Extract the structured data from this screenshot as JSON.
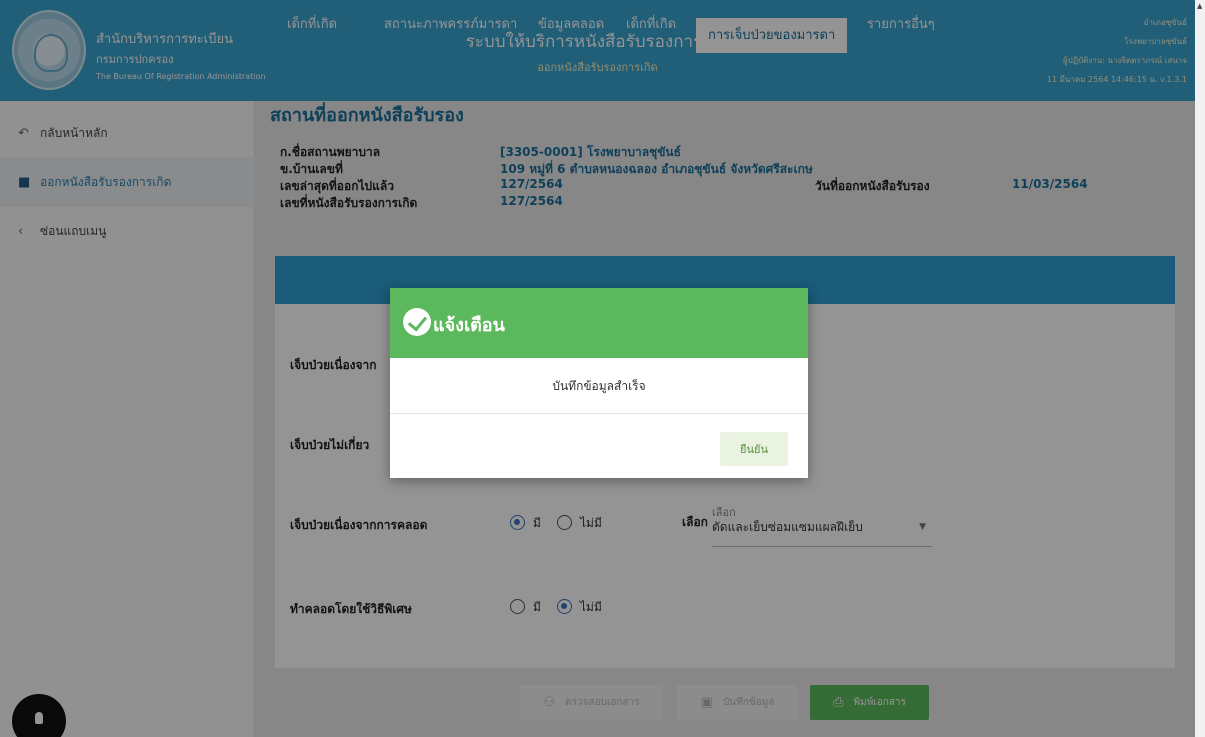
{
  "header": {
    "org_line1": "สำนักบริหารการทะเบียน",
    "org_line2": "กรมการปกครอง",
    "org_line3": "The Bureau Of Registration Administration",
    "system_title": "ระบบให้บริการหนังสือรับรองการเกิด",
    "system_subtitle": "ออกหนังสือรับรองการเกิด",
    "user_district": "อำเภอชุขันธ์",
    "user_hospital": "โรงพยาบาลชุขันธ์",
    "user_name": "ผู้ปฏิบัติงาน: นางจิตตราภรณ์ เสนาจ",
    "datetime_version": "11 มีนาคม 2564 14:46:15 น.  v.1.3.1"
  },
  "sidebar": {
    "items": [
      {
        "label": "กลับหน้าหลัก",
        "icon": "back-icon"
      },
      {
        "label": "ออกหนังสือรับรองการเกิด",
        "icon": "document-icon"
      },
      {
        "label": "ซ่อนแถบเมนู",
        "icon": "chevron-left-icon"
      }
    ]
  },
  "main": {
    "title": "สถานที่ออกหนังสือรับรอง",
    "info": {
      "hospital_label": "ก.ชื่อสถานพยาบาล",
      "hospital_value": "[3305-0001] โรงพยาบาลชุขันธ์",
      "address_label": "ข.บ้านเลขที่",
      "address_value": "109 หมู่ที่ 6 ตำบลหนองฉลอง อำเภอชุขันธ์ จังหวัดศรีสะเกษ",
      "last_no_label": "เลขล่าสุดที่ออกไปแล้ว",
      "last_no_value": "127/2564",
      "issue_date_label": "วันที่ออกหนังสือรับรอง",
      "issue_date_value": "11/03/2564",
      "cert_no_label": "เลขที่หนังสือรับรองการเกิด",
      "cert_no_value": "127/2564"
    },
    "tabs": [
      "เด็กที่เกิด",
      "สถานะภาพครรภ์มารดา",
      "ข้อมูลคลอด",
      "เด็กที่เกิด",
      "การเจ็บป่วยของมารดา",
      "รายการอื่นๆ"
    ],
    "questions": [
      {
        "label": "เจ็บป่วยเนื่องจาก"
      },
      {
        "label": "เจ็บป่วยไม่เกี่ยว"
      },
      {
        "label": "เจ็บป่วยเนื่องจากการคลอด",
        "opt_yes": "มี",
        "opt_no": "ไม่มี",
        "selected": "yes"
      },
      {
        "label": "ทำคลอดโดยใช้วิธีพิเศษ",
        "opt_yes": "มี",
        "opt_no": "ไม่มี",
        "selected": "no"
      }
    ],
    "select": {
      "label": "เลือก",
      "caption": "เลือก",
      "value": "ตัดและเย็บซ่อมแซมแผลฝีเย็บ"
    },
    "buttons": {
      "review": "ตรวจสอบเอกสาร",
      "save": "บันทึกข้อมูล",
      "print": "พิมพ์เอกสาร"
    }
  },
  "dialog": {
    "title": "แจ้งเตือน",
    "message": "บันทึกข้อมูลสำเร็จ",
    "confirm": "ยืนยัน"
  }
}
